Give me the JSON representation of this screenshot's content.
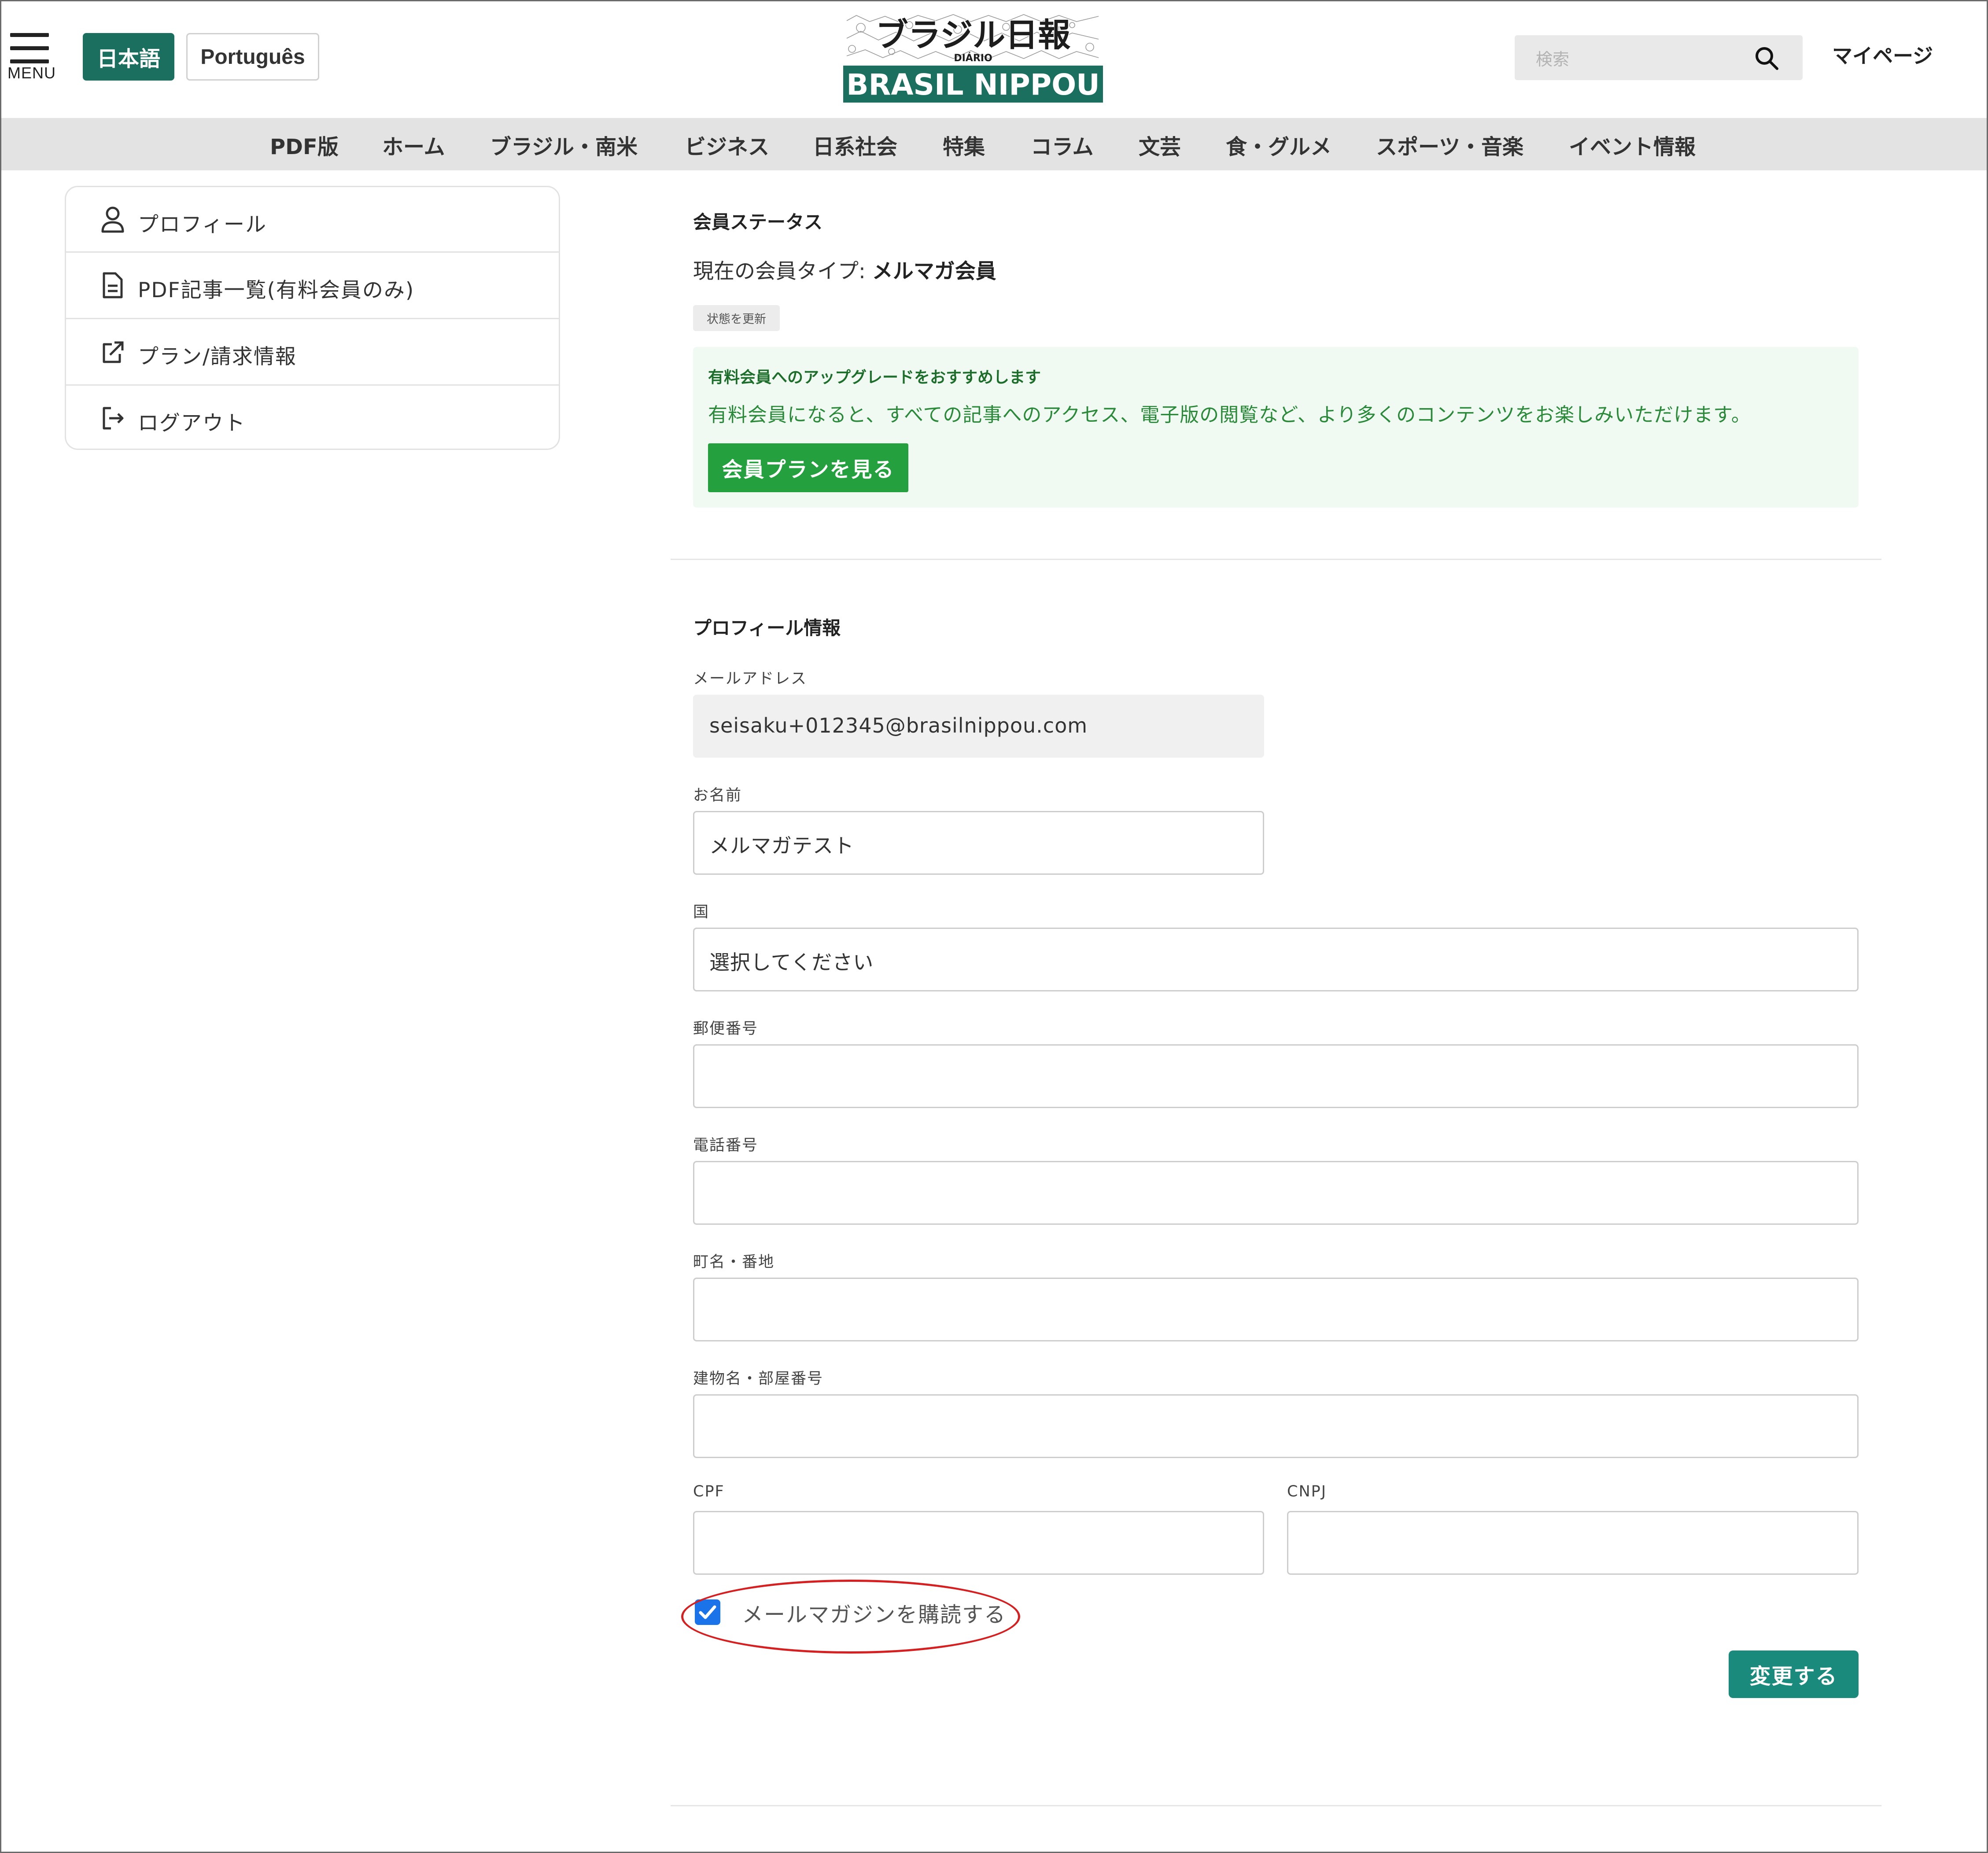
{
  "header": {
    "menu_label": "MENU",
    "lang_ja": "日本語",
    "lang_pt": "Português",
    "logo_top": "ブラジル日報",
    "logo_small": "DIÁRIO",
    "logo_bottom": "BRASIL NIPPOU",
    "search_placeholder": "検索",
    "mypage": "マイページ"
  },
  "nav": [
    "PDF版",
    "ホーム",
    "ブラジル・南米",
    "ビジネス",
    "日系社会",
    "特集",
    "コラム",
    "文芸",
    "食・グルメ",
    "スポーツ・音楽",
    "イベント情報"
  ],
  "sidebar": {
    "items": [
      {
        "label": "プロフィール",
        "icon": "user-icon"
      },
      {
        "label": "PDF記事一覧(有料会員のみ)",
        "icon": "document-icon"
      },
      {
        "label": "プラン/請求情報",
        "icon": "external-link-icon"
      },
      {
        "label": "ログアウト",
        "icon": "logout-icon"
      }
    ]
  },
  "status": {
    "heading": "会員ステータス",
    "type_prefix": "現在の会員タイプ: ",
    "type_value": "メルマガ会員",
    "refresh_label": "状態を更新",
    "upgrade_title": "有料会員へのアップグレードをおすすめします",
    "upgrade_text": "有料会員になると、すべての記事へのアクセス、電子版の閲覧など、より多くのコンテンツをお楽しみいただけます。",
    "plans_button": "会員プランを見る"
  },
  "profile": {
    "heading": "プロフィール情報",
    "email_label": "メールアドレス",
    "email_value": "seisaku+012345@brasilnippou.com",
    "name_label": "お名前",
    "name_value": "メルマガテスト",
    "country_label": "国",
    "country_value": "選択してください",
    "zip_label": "郵便番号",
    "zip_value": "",
    "phone_label": "電話番号",
    "phone_value": "",
    "address_label": "町名・番地",
    "address_value": "",
    "building_label": "建物名・部屋番号",
    "building_value": "",
    "cpf_label": "CPF",
    "cpf_value": "",
    "cnpj_label": "CNPJ",
    "cnpj_value": "",
    "newsletter_label": "メールマガジンを購読する",
    "newsletter_checked": true,
    "submit_label": "変更する"
  },
  "colors": {
    "brand_green": "#1a6f5f",
    "cta_green": "#24a03f",
    "submit_teal": "#1a8a7c",
    "checkbox_blue": "#1a73e8",
    "annotation_red": "#d42020"
  }
}
